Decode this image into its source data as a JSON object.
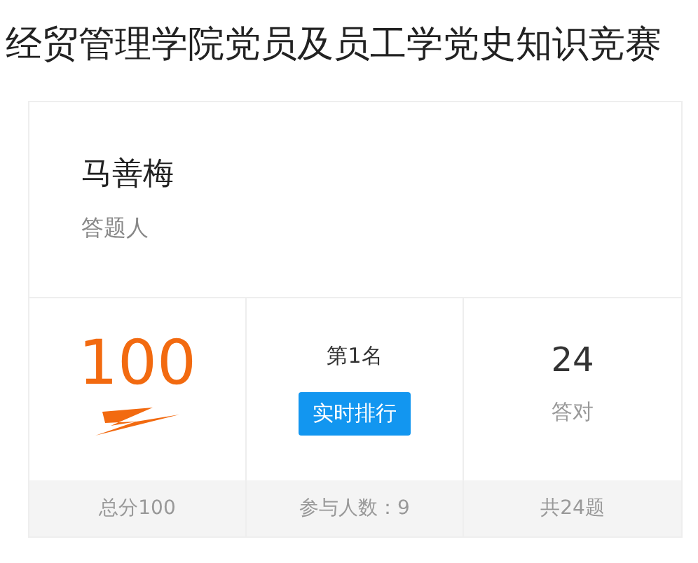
{
  "title": "经贸管理学院党员及员工学党史知识竞赛",
  "respondent": {
    "name": "马善梅",
    "label": "答题人"
  },
  "stats": [
    {
      "kind": "score",
      "value": "100",
      "footer": "总分100"
    },
    {
      "kind": "rank",
      "value": "第1名",
      "button": "实时排行",
      "footer": "参与人数：9"
    },
    {
      "kind": "correct",
      "value": "24",
      "caption": "答对",
      "footer": "共24题"
    }
  ]
}
